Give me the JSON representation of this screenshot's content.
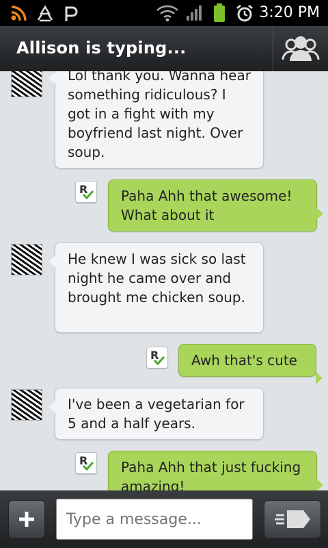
{
  "status_bar": {
    "time": "3:20 PM",
    "icons": [
      "wifi-hotspot-icon",
      "recycle-icon",
      "p-icon",
      "wifi-icon",
      "signal-icon",
      "battery-icon",
      "alarm-icon"
    ]
  },
  "header": {
    "title": "Allison is typing...",
    "contacts_icon": "contacts-icon"
  },
  "messages": [
    {
      "direction": "in",
      "text": "Lol thank you. Wanna hear something ridiculous? I got in a fight with my boyfriend last night. Over soup."
    },
    {
      "direction": "out",
      "text": "Paha Ahh that awesome! What about it",
      "receipt": "R"
    },
    {
      "direction": "in",
      "text": "He knew I was sick so last night he came over and brought me chicken soup."
    },
    {
      "direction": "out",
      "text": "Awh that's cute",
      "receipt": "R"
    },
    {
      "direction": "in",
      "text": "I've been a vegetarian for 5 and a half years."
    },
    {
      "direction": "out",
      "text": "Paha Ahh that just fucking amazing!",
      "receipt": "R"
    }
  ],
  "composer": {
    "placeholder": "Type a message...",
    "add_icon": "plus-icon",
    "send_icon": "send-icon"
  },
  "colors": {
    "incoming_bubble": "#f2f4f6",
    "outgoing_bubble": "#a9d65a",
    "chat_background": "#dfe3e6",
    "bar_background": "#2b2e30"
  }
}
